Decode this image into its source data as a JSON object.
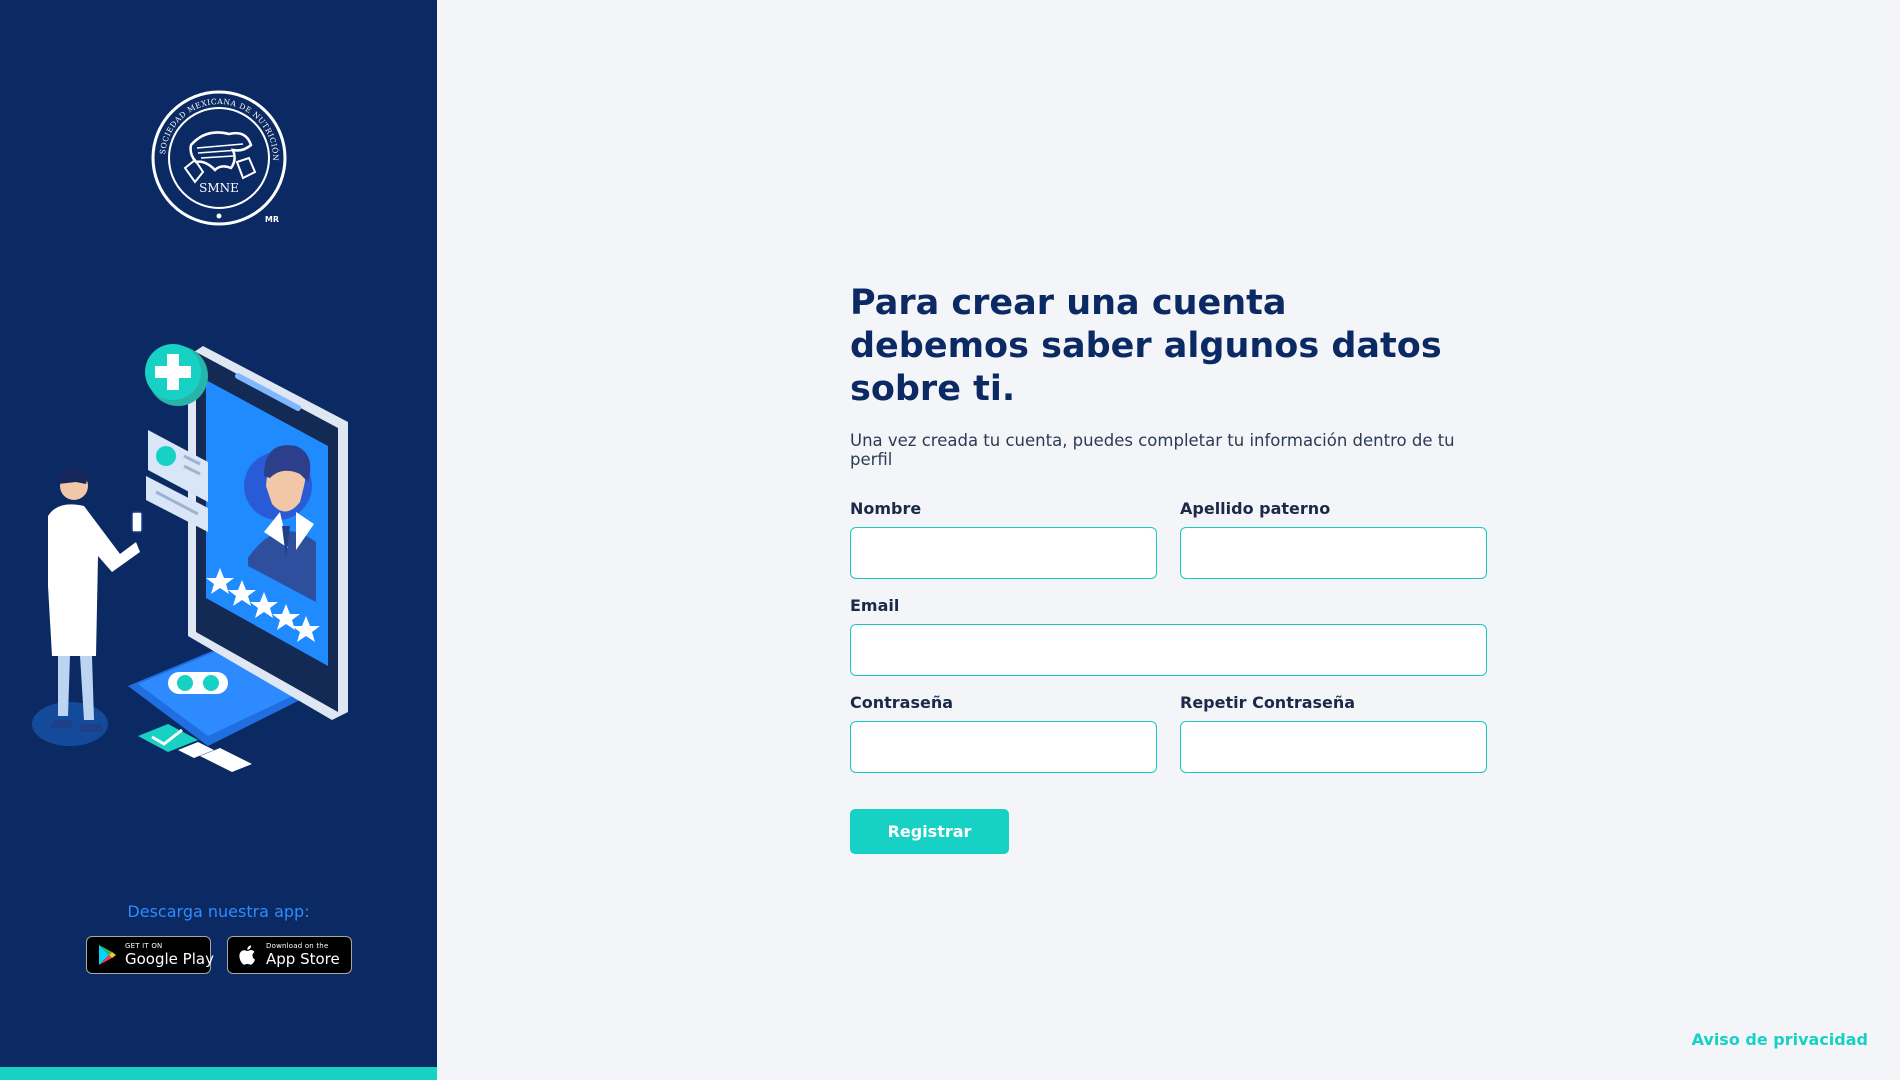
{
  "sidebar": {
    "logo": {
      "name": "SOCIEDAD MEXICANA DE NUTRICIÓN Y ENDOCRINOLOGÍA",
      "abbr": "SMNE",
      "mark": "MR"
    },
    "download_label": "Descarga nuestra app:",
    "badges": [
      {
        "small": "GET IT ON",
        "big": "Google Play",
        "icon": "google-play-icon"
      },
      {
        "small": "Download on the",
        "big": "App Store",
        "icon": "apple-icon"
      }
    ]
  },
  "form": {
    "title": "Para crear una cuenta debemos saber algunos datos sobre ti.",
    "subtitle": "Una vez creada tu cuenta, puedes completar tu información dentro de tu perfil",
    "fields": {
      "nombre": {
        "label": "Nombre",
        "value": ""
      },
      "apellido": {
        "label": "Apellido paterno",
        "value": ""
      },
      "email": {
        "label": "Email",
        "value": ""
      },
      "password": {
        "label": "Contraseña",
        "value": ""
      },
      "repeat_password": {
        "label": "Repetir Contraseña",
        "value": ""
      }
    },
    "submit_label": "Registrar"
  },
  "footer": {
    "privacy_label": "Aviso de privacidad"
  },
  "colors": {
    "sidebar": "#0b2a63",
    "accent": "#18d1c5",
    "link_blue": "#2e8bff",
    "title": "#0b2a63",
    "background": "#f4f5f8"
  }
}
